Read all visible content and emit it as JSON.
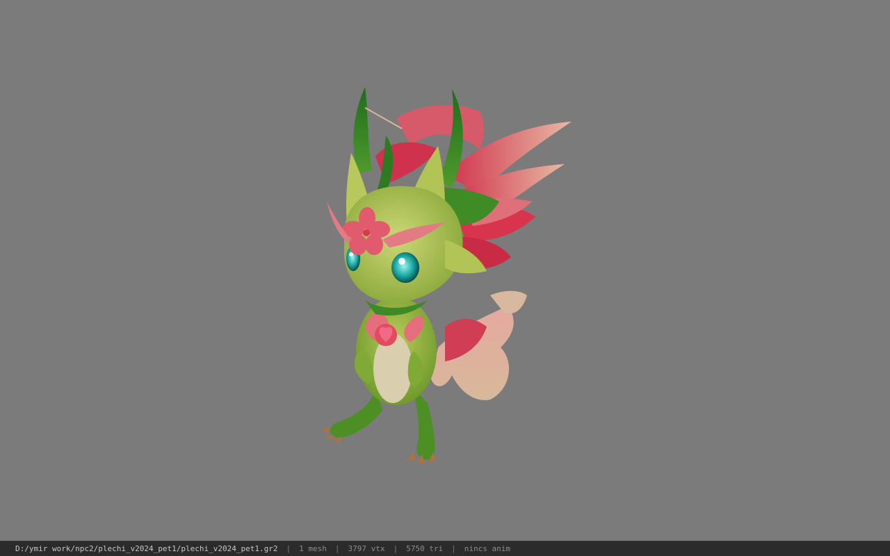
{
  "viewport": {
    "background": "#7b7b7b",
    "model_description_icon": "dragon-pet-model"
  },
  "statusbar": {
    "path": "D:/ymir work/npc2/plechi_v2024_pet1/plechi_v2024_pet1.gr2",
    "sep": "|",
    "mesh": "1 mesh",
    "vtx": "3797 vtx",
    "tri": "5750 tri",
    "anim": "nincs anim"
  }
}
